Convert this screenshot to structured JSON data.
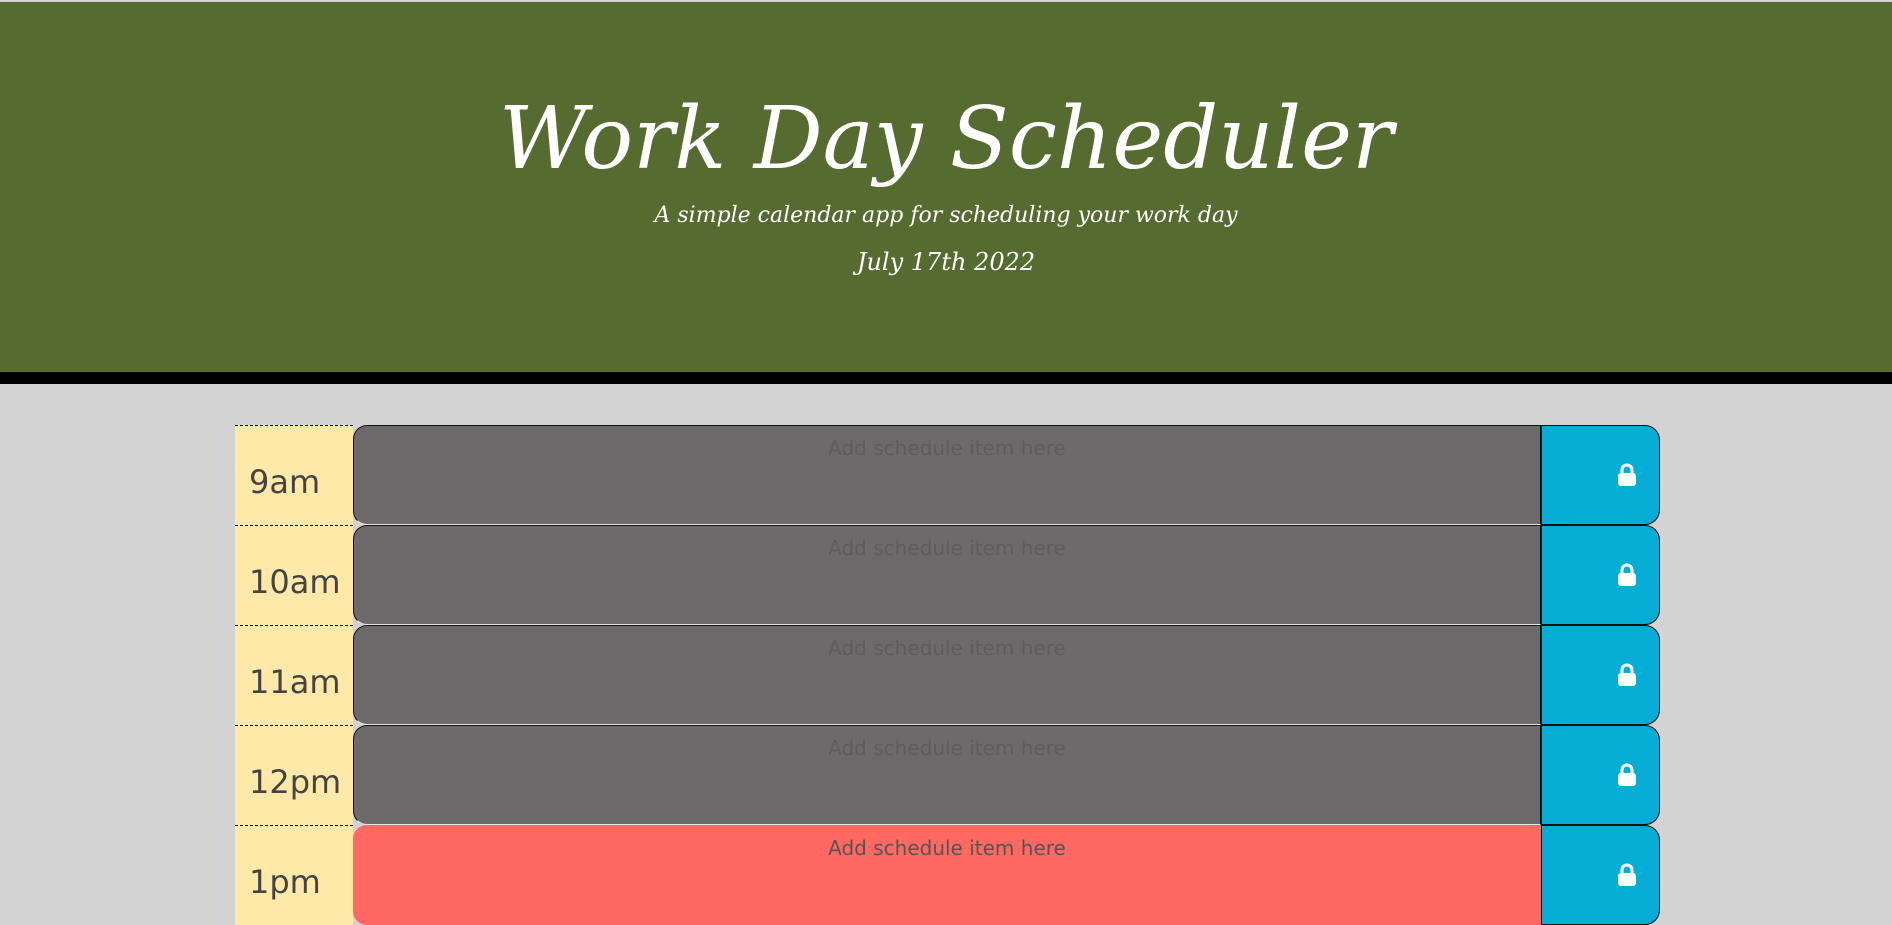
{
  "header": {
    "title": "Work Day Scheduler",
    "subtitle": "A simple calendar app for scheduling your work day",
    "current_day": "July 17th 2022"
  },
  "colors": {
    "header_bg": "#556b2f",
    "page_bg": "#d3d3d3",
    "hour_bg": "#ffe9a8",
    "past": "#6c6a6b",
    "present": "#ff6961",
    "save_button": "#06aed5"
  },
  "time_blocks": [
    {
      "hour": "9am",
      "placeholder": "Add schedule item here",
      "state": "past",
      "save_icon": "lock-icon"
    },
    {
      "hour": "10am",
      "placeholder": "Add schedule item here",
      "state": "past",
      "save_icon": "lock-icon"
    },
    {
      "hour": "11am",
      "placeholder": "Add schedule item here",
      "state": "past",
      "save_icon": "lock-icon"
    },
    {
      "hour": "12pm",
      "placeholder": "Add schedule item here",
      "state": "past",
      "save_icon": "lock-icon"
    },
    {
      "hour": "1pm",
      "placeholder": "Add schedule item here",
      "state": "present",
      "save_icon": "lock-icon"
    }
  ]
}
